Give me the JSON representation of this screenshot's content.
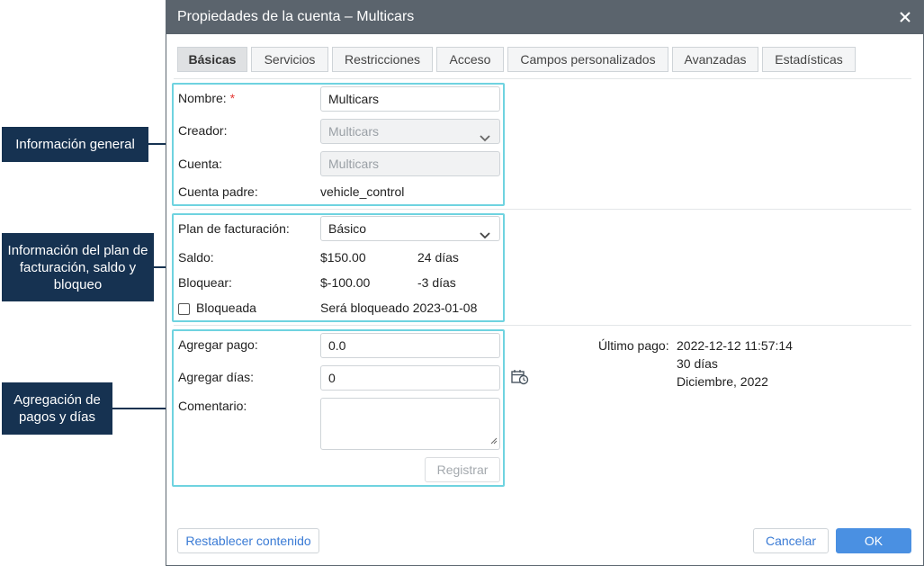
{
  "dialog": {
    "title": "Propiedades de la cuenta – Multicars",
    "tabs": [
      {
        "label": "Básicas",
        "active": true
      },
      {
        "label": "Servicios"
      },
      {
        "label": "Restricciones"
      },
      {
        "label": "Acceso"
      },
      {
        "label": "Campos personalizados"
      },
      {
        "label": "Avanzadas"
      },
      {
        "label": "Estadísticas"
      }
    ]
  },
  "general": {
    "name_label": "Nombre:",
    "required_mark": "*",
    "name_value": "Multicars",
    "creator_label": "Creador:",
    "creator_value": "Multicars",
    "account_label": "Cuenta:",
    "account_value": "Multicars",
    "parent_label": "Cuenta padre:",
    "parent_value": "vehicle_control"
  },
  "billing": {
    "plan_label": "Plan de facturación:",
    "plan_value": "Básico",
    "balance_label": "Saldo:",
    "balance_value": "$150.00",
    "balance_days": "24 días",
    "block_label": "Bloquear:",
    "block_value": "$-100.00",
    "block_days": "-3 días",
    "blocked_label": "Bloqueada",
    "blocked_checked": false,
    "will_block": "Será bloqueado 2023-01-08"
  },
  "payment": {
    "add_payment_label": "Agregar pago:",
    "add_payment_value": "0.0",
    "add_days_label": "Agregar días:",
    "add_days_value": "0",
    "comment_label": "Comentario:",
    "register_label": "Registrar",
    "last_payment_label": "Último pago:",
    "last_payment_date": "2022-12-12 11:57:14",
    "last_payment_days": "30 días",
    "last_payment_month": "Diciembre, 2022"
  },
  "footer": {
    "reset_label": "Restablecer contenido",
    "cancel_label": "Cancelar",
    "ok_label": "OK"
  },
  "callouts": {
    "general": "Información general",
    "billing": "Información del plan de facturación, saldo y bloqueo",
    "payment": "Agregación de pagos y días"
  },
  "icons": {
    "close": "close-icon",
    "dropdown": "chevron-down-icon",
    "history": "calendar-clock-icon",
    "resize": "resize-grip-icon"
  },
  "colors": {
    "titlebar": "#5b646d",
    "highlight": "#6fd3e0",
    "callout": "#163251",
    "primary": "#4a90e2",
    "link": "#3a7bd5",
    "required": "#e53935"
  }
}
